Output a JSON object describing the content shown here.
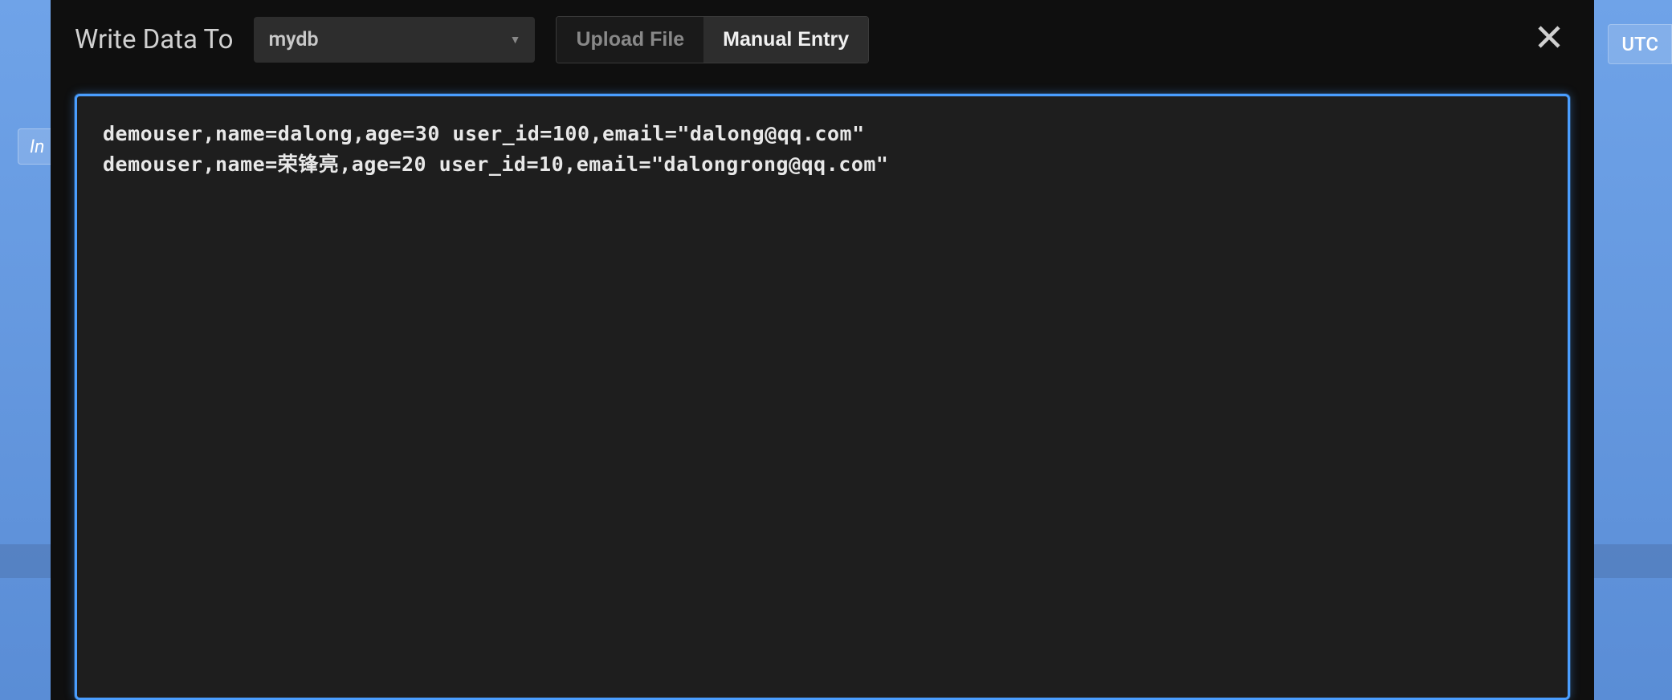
{
  "background": {
    "left_btn": "In",
    "help_icon": "?",
    "utc_label": "UTC"
  },
  "modal": {
    "title": "Write Data To",
    "database_selected": "mydb",
    "toggle": {
      "upload": "Upload File",
      "manual": "Manual Entry"
    },
    "textarea_value": "demouser,name=dalong,age=30 user_id=100,email=\"dalong@qq.com\"\ndemouser,name=荣锋亮,age=20 user_id=10,email=\"dalongrong@qq.com\""
  }
}
